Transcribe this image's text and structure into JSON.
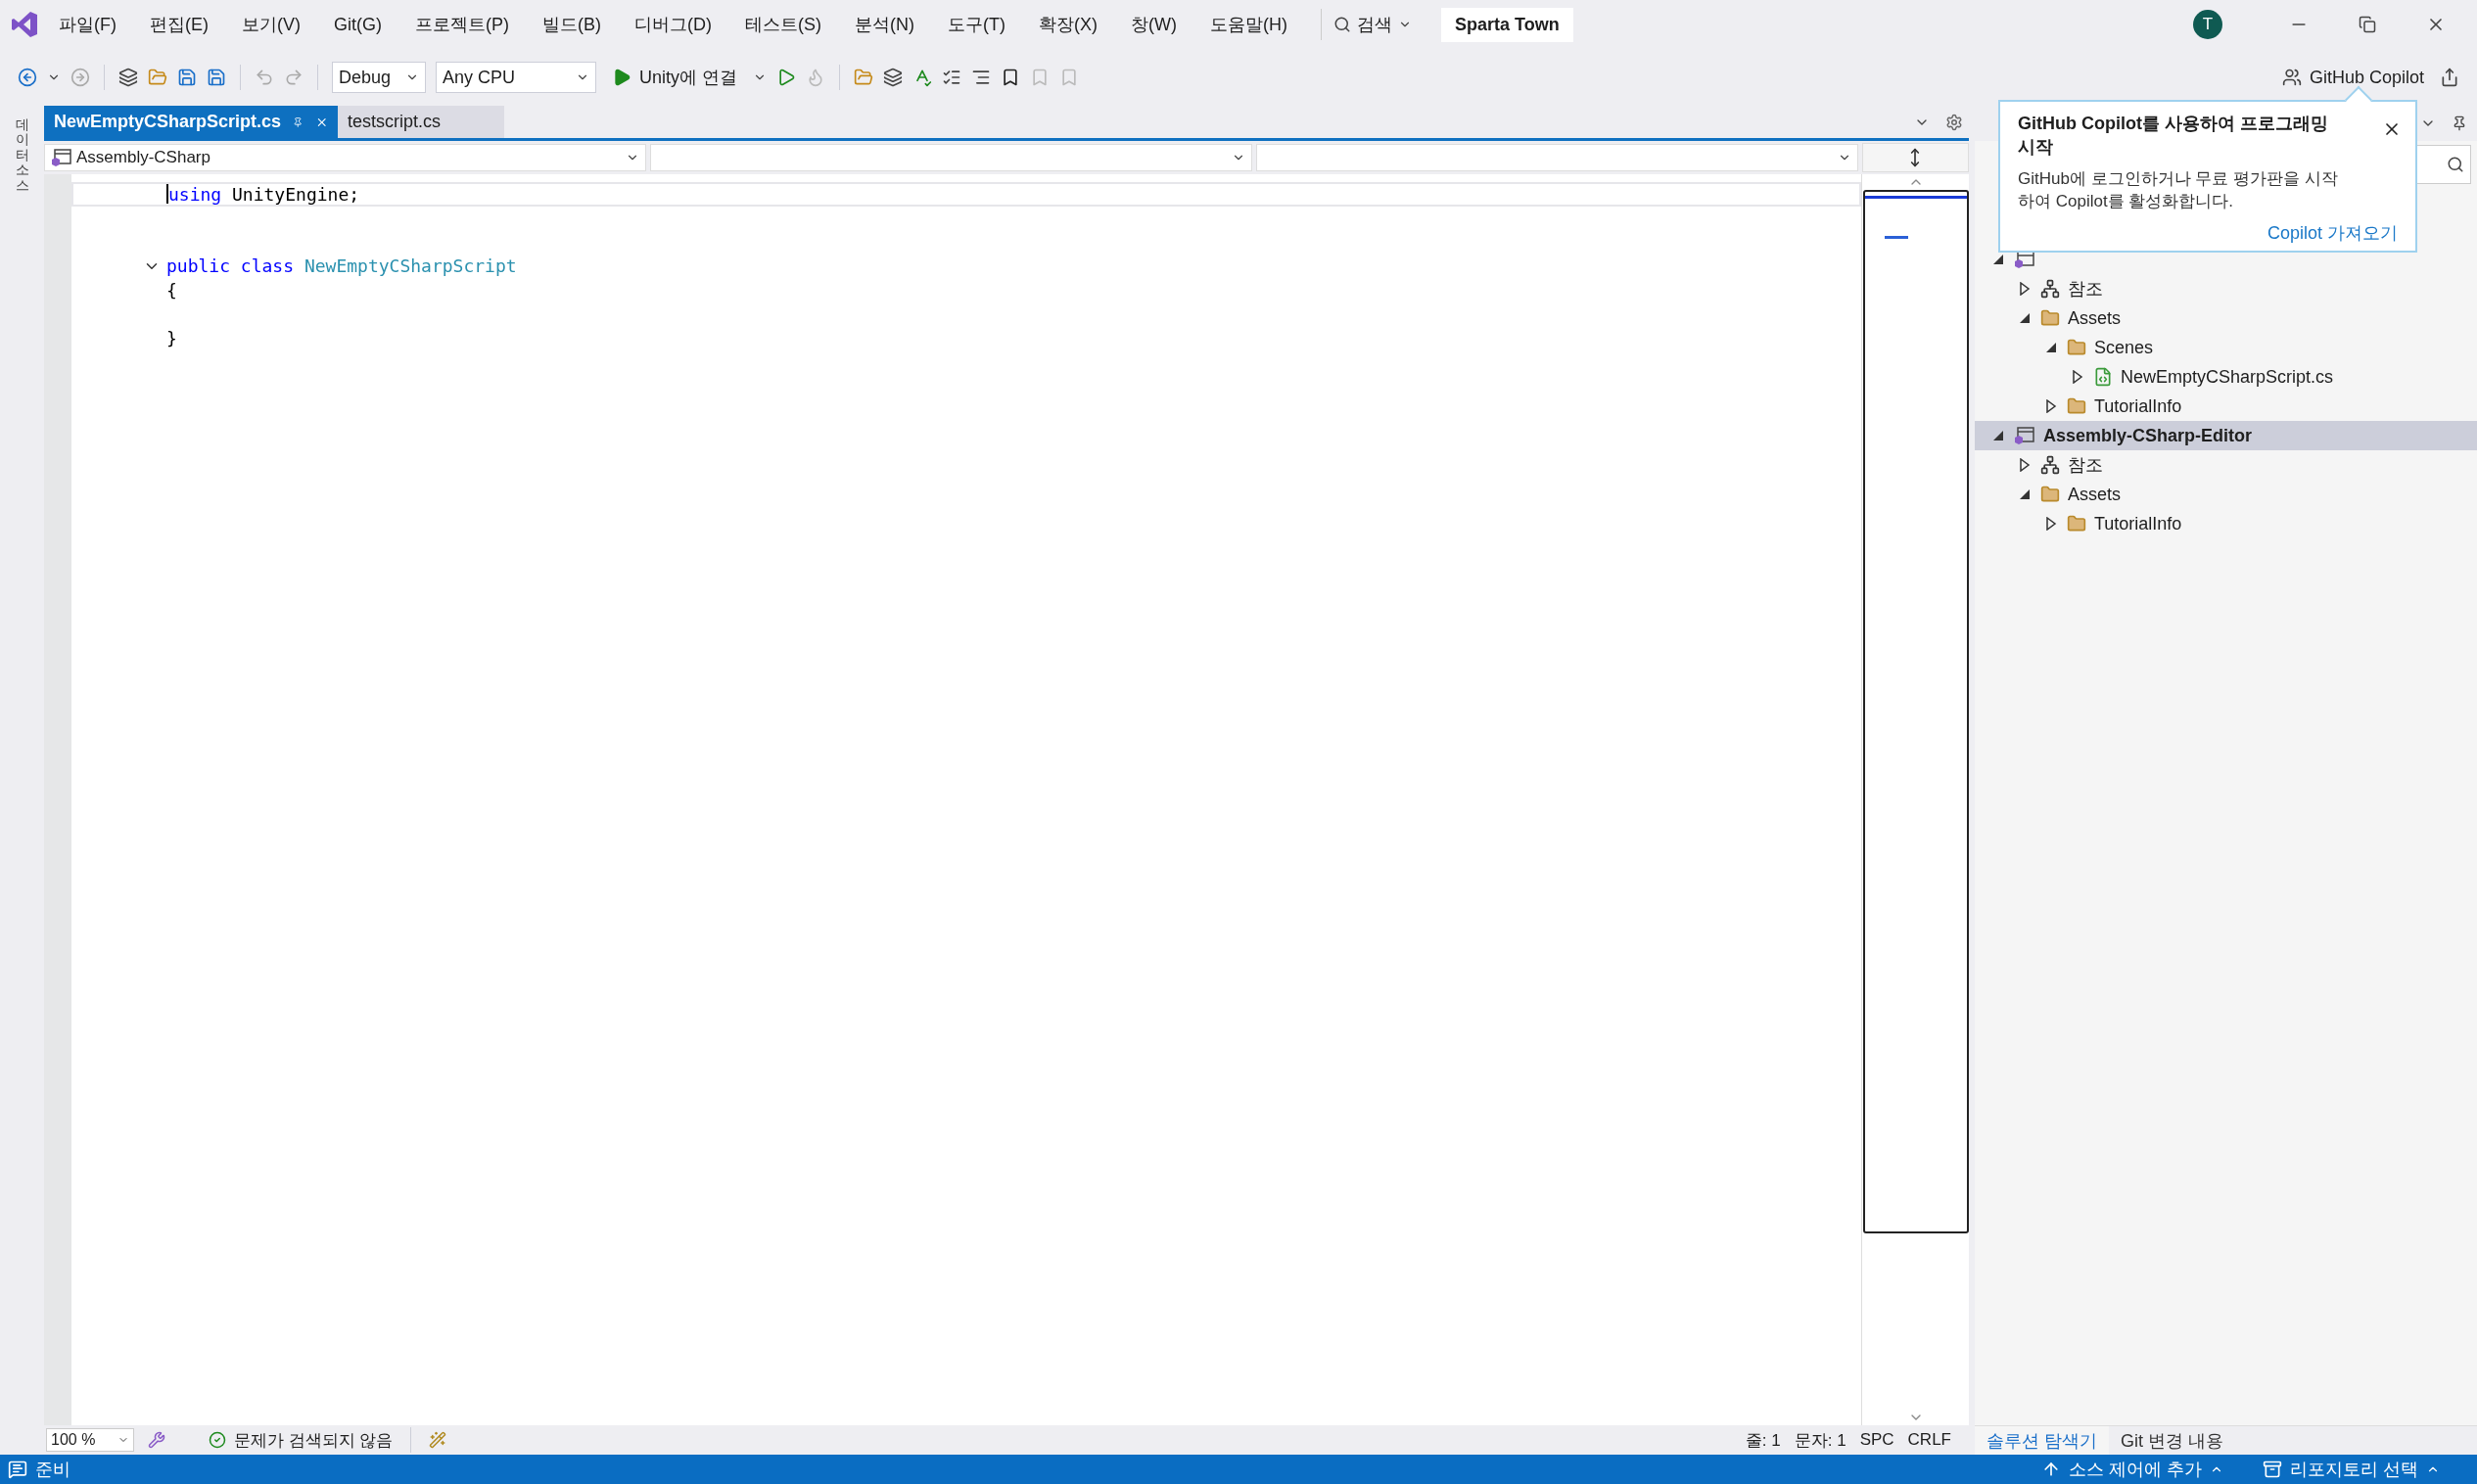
{
  "menu": [
    "파일(F)",
    "편집(E)",
    "보기(V)",
    "Git(G)",
    "프로젝트(P)",
    "빌드(B)",
    "디버그(D)",
    "테스트(S)",
    "분석(N)",
    "도구(T)",
    "확장(X)",
    "창(W)",
    "도움말(H)"
  ],
  "search": {
    "label": "검색"
  },
  "solution_name": "Sparta Town",
  "user_initial": "T",
  "toolbar": {
    "configuration": "Debug",
    "platform": "Any CPU",
    "run_label": "Unity에 연결",
    "copilot": "GitHub Copilot"
  },
  "side_strip": "데이터 소스",
  "tabs": [
    {
      "label": "NewEmptyCSharpScript.cs",
      "selected": true
    },
    {
      "label": "testscript.cs",
      "selected": false
    }
  ],
  "nav_bar": {
    "project": "Assembly-CSharp"
  },
  "code_lines": [
    {
      "current": true,
      "fold_start": false,
      "tokens": [
        {
          "kind": "keyword",
          "text": "using"
        },
        {
          "kind": "plain",
          "text": " UnityEngine;"
        }
      ]
    },
    {
      "current": false,
      "fold_start": false
    },
    {
      "current": false,
      "fold_start": false
    },
    {
      "current": false,
      "fold_start": true,
      "tokens": [
        {
          "kind": "keyword",
          "text": "public class"
        },
        {
          "kind": "type",
          "text": " NewEmptyCSharpScript"
        }
      ]
    },
    {
      "current": false,
      "fold_start": false,
      "tokens": [
        {
          "kind": "plain",
          "text": "{"
        }
      ]
    },
    {
      "current": false,
      "fold_start": false
    },
    {
      "current": false,
      "fold_start": false,
      "tokens": [
        {
          "kind": "plain",
          "text": "}"
        }
      ]
    }
  ],
  "editor_status": {
    "zoom": "100 %",
    "issues": "문제가 검색되지 않음",
    "line": "줄: 1",
    "column": "문자: 1",
    "spacing": "SPC",
    "line_ending": "CRLF"
  },
  "solution_explorer": {
    "tree": [
      {
        "kind": "project",
        "expanded": true,
        "selected": false,
        "children": [
          {
            "kind": "references",
            "label": "참조",
            "expanded": false,
            "selected": false
          },
          {
            "kind": "folder",
            "label": "Assets",
            "expanded": true,
            "selected": false,
            "children": [
              {
                "kind": "folder",
                "label": "Scenes",
                "expanded": true,
                "selected": false,
                "children": [
                  {
                    "kind": "csfile",
                    "label": "NewEmptyCSharpScript.cs",
                    "expanded": false,
                    "selected": false
                  }
                ]
              },
              {
                "kind": "folder",
                "label": "TutorialInfo",
                "expanded": false,
                "selected": false
              }
            ]
          }
        ]
      },
      {
        "kind": "project",
        "label": "Assembly-CSharp-Editor",
        "expanded": true,
        "selected": true,
        "children": [
          {
            "kind": "references",
            "label": "참조",
            "expanded": false,
            "selected": false
          },
          {
            "kind": "folder",
            "label": "Assets",
            "expanded": true,
            "selected": false,
            "children": [
              {
                "kind": "folder",
                "label": "TutorialInfo",
                "expanded": false,
                "selected": false
              }
            ]
          }
        ]
      }
    ],
    "tabs": [
      {
        "label": "솔루션 탐색기",
        "selected": true
      },
      {
        "label": "Git 변경 내용",
        "selected": false
      }
    ]
  },
  "copilot_popup": {
    "title": "GitHub Copilot를 사용하여 프로그래밍 시작",
    "body": "GitHub에 로그인하거나 무료 평가판을 시작하여 Copilot를 활성화합니다.",
    "link": "Copilot 가져오기"
  },
  "status_bar": {
    "text": "준비",
    "source_control": "소스 제어에 추가",
    "repository": "리포지토리 선택"
  }
}
